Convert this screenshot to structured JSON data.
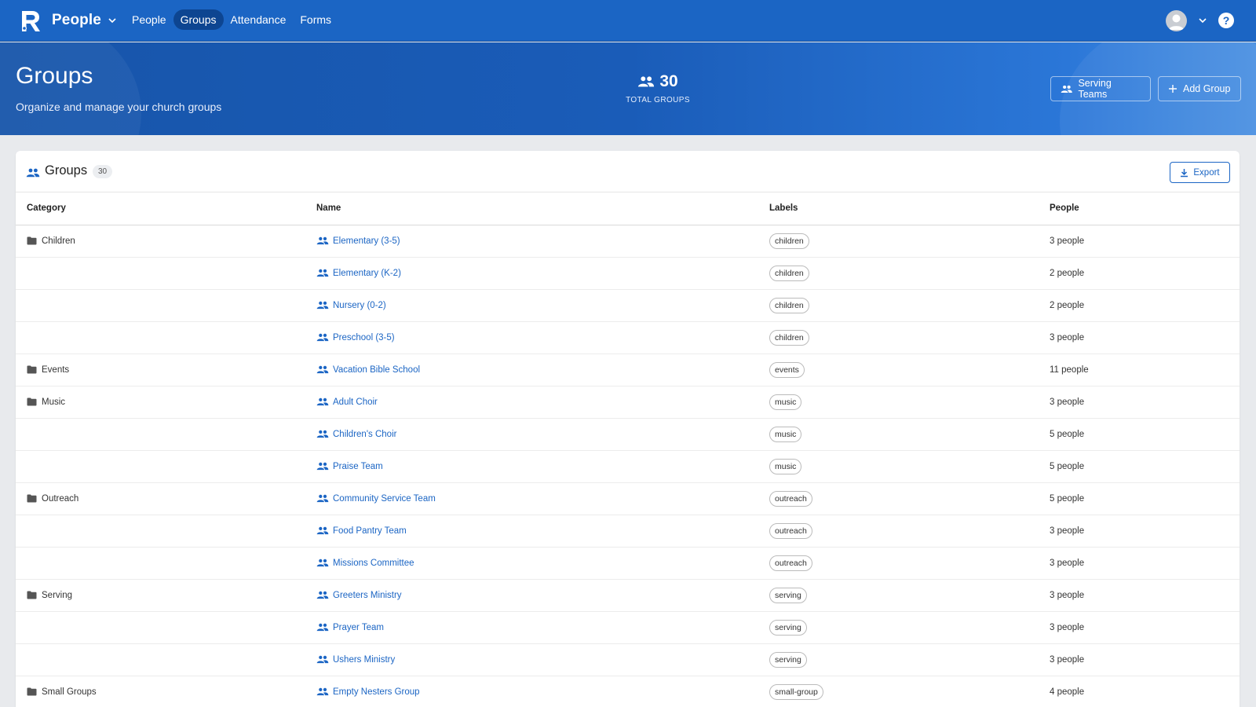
{
  "nav": {
    "app_name": "People",
    "items": [
      {
        "label": "People",
        "active": false
      },
      {
        "label": "Groups",
        "active": true
      },
      {
        "label": "Attendance",
        "active": false
      },
      {
        "label": "Forms",
        "active": false
      }
    ],
    "help_label": "?"
  },
  "hero": {
    "title": "Groups",
    "subtitle": "Organize and manage your church groups",
    "stat_value": "30",
    "stat_label": "TOTAL GROUPS",
    "serving_teams_label": "Serving Teams",
    "add_group_label": "Add Group"
  },
  "card": {
    "title": "Groups",
    "count": "30",
    "export_label": "Export"
  },
  "table": {
    "headers": {
      "category": "Category",
      "name": "Name",
      "labels": "Labels",
      "people": "People"
    },
    "rows": [
      {
        "category": "Children",
        "name": "Elementary (3-5)",
        "label": "children",
        "people": "3 people"
      },
      {
        "category": "",
        "name": "Elementary (K-2)",
        "label": "children",
        "people": "2 people"
      },
      {
        "category": "",
        "name": "Nursery (0-2)",
        "label": "children",
        "people": "2 people"
      },
      {
        "category": "",
        "name": "Preschool (3-5)",
        "label": "children",
        "people": "3 people"
      },
      {
        "category": "Events",
        "name": "Vacation Bible School",
        "label": "events",
        "people": "11 people"
      },
      {
        "category": "Music",
        "name": "Adult Choir",
        "label": "music",
        "people": "3 people"
      },
      {
        "category": "",
        "name": "Children's Choir",
        "label": "music",
        "people": "5 people"
      },
      {
        "category": "",
        "name": "Praise Team",
        "label": "music",
        "people": "5 people"
      },
      {
        "category": "Outreach",
        "name": "Community Service Team",
        "label": "outreach",
        "people": "5 people"
      },
      {
        "category": "",
        "name": "Food Pantry Team",
        "label": "outreach",
        "people": "3 people"
      },
      {
        "category": "",
        "name": "Missions Committee",
        "label": "outreach",
        "people": "3 people"
      },
      {
        "category": "Serving",
        "name": "Greeters Ministry",
        "label": "serving",
        "people": "3 people"
      },
      {
        "category": "",
        "name": "Prayer Team",
        "label": "serving",
        "people": "3 people"
      },
      {
        "category": "",
        "name": "Ushers Ministry",
        "label": "serving",
        "people": "3 people"
      },
      {
        "category": "Small Groups",
        "name": "Empty Nesters Group",
        "label": "small-group",
        "people": "4 people"
      }
    ]
  },
  "colors": {
    "brand": "#1b65c4",
    "nav_active": "#0d4591",
    "link": "#1b65c4"
  },
  "icons": {
    "logo": "app-logo-icon",
    "people": "people-group-icon",
    "folder": "folder-icon",
    "download": "download-icon",
    "plus": "plus-icon"
  }
}
